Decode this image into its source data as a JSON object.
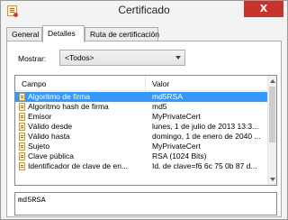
{
  "window": {
    "title": "Certificado",
    "close_symbol": "X"
  },
  "tabs": [
    {
      "label": "General"
    },
    {
      "label": "Detalles"
    },
    {
      "label": "Ruta de certificación"
    }
  ],
  "mostrar": {
    "label": "Mostrar:",
    "value": "<Todos>"
  },
  "table": {
    "columns": {
      "field": "Campo",
      "value": "Valor"
    },
    "rows": [
      {
        "field": "Algoritmo de firma",
        "value": "md5RSA",
        "icon": "certificate-field-icon",
        "selected": true
      },
      {
        "field": "Algoritmo hash de firma",
        "value": "md5",
        "icon": "certificate-field-icon"
      },
      {
        "field": "Emisor",
        "value": "MyPrivateCert",
        "icon": "certificate-field-icon"
      },
      {
        "field": "Válido desde",
        "value": "lunes, 1 de julio de 2013 13:3...",
        "icon": "certificate-field-icon"
      },
      {
        "field": "Válido hasta",
        "value": "domingo, 1 de enero de 2040 ...",
        "icon": "certificate-field-icon"
      },
      {
        "field": "Sujeto",
        "value": "MyPrivateCert",
        "icon": "certificate-field-icon"
      },
      {
        "field": "Clave pública",
        "value": "RSA (1024 Bits)",
        "icon": "certificate-field-icon"
      },
      {
        "field": "Identificador de clave de en...",
        "value": "Id. de clave=f6 6c 75 0b 87 d...",
        "icon": "certificate-field-icon"
      }
    ]
  },
  "detail": {
    "text": "md5RSA"
  },
  "colors": {
    "selection": "#3399ff",
    "close_button": "#c7342c"
  }
}
